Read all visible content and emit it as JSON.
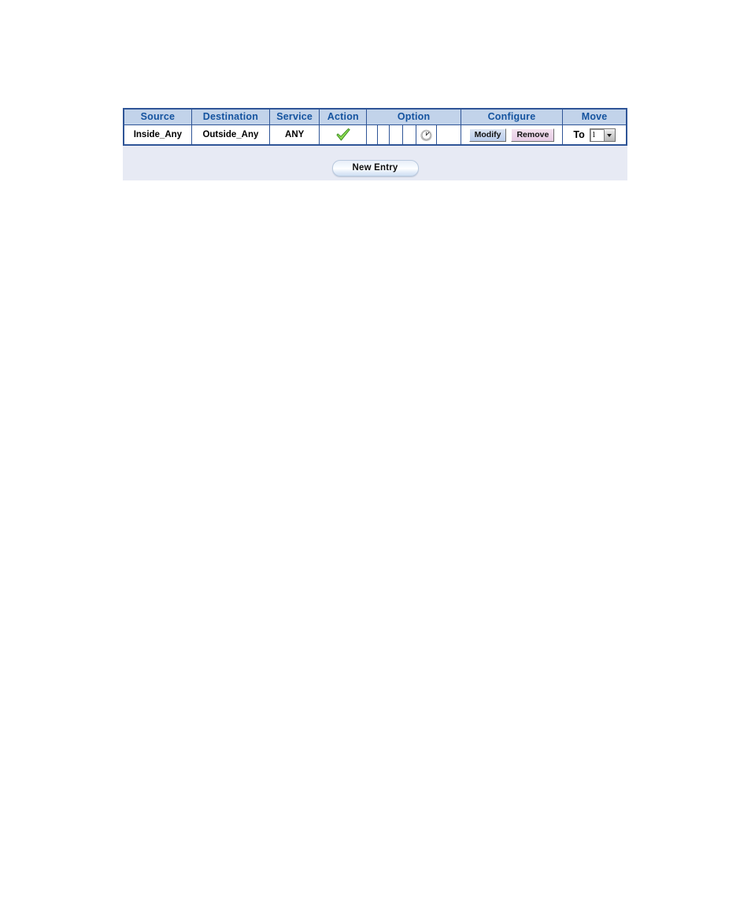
{
  "table": {
    "headers": [
      {
        "label": "Source",
        "name": "col-source"
      },
      {
        "label": "Destination",
        "name": "col-destination"
      },
      {
        "label": "Service",
        "name": "col-service"
      },
      {
        "label": "Action",
        "name": "col-action"
      },
      {
        "label": "Option",
        "name": "col-option"
      },
      {
        "label": "Configure",
        "name": "col-configure"
      },
      {
        "label": "Move",
        "name": "col-move"
      }
    ],
    "rows": [
      {
        "source": "Inside_Any",
        "destination": "Outside_Any",
        "service": "ANY",
        "action_icon": "green-check-icon",
        "option_cells": [
          "",
          "",
          "",
          "",
          "schedule-clock-icon",
          ""
        ],
        "configure": {
          "modify_label": "Modify",
          "remove_label": "Remove"
        },
        "move": {
          "label": "To",
          "selected": "1",
          "options": [
            "1"
          ]
        }
      }
    ]
  },
  "footer": {
    "new_entry_label": "New Entry"
  },
  "colors": {
    "border": "#2f5597",
    "header_bg": "#c2d3ea",
    "header_text": "#14539f",
    "panel_bg": "#e7eaf4",
    "row_bg": "#ffffff",
    "check_green": "#8ede54",
    "check_green_outline": "#3f8f22",
    "modify_btn": "#b9ccec",
    "remove_btn": "#e6cbe4"
  }
}
